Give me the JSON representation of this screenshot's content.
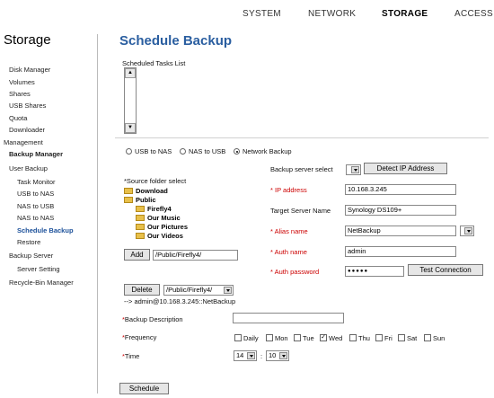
{
  "nav": {
    "system": "SYSTEM",
    "network": "NETWORK",
    "storage": "STORAGE",
    "access": "ACCESS"
  },
  "sidebar": {
    "title": "Storage",
    "items": [
      "Disk Manager",
      "Volumes",
      "Shares",
      "USB Shares",
      "Quota",
      "Downloader",
      "Management",
      "Backup Manager",
      "User Backup",
      "Task Monitor",
      "USB to NAS",
      "NAS to USB",
      "NAS to NAS",
      "Schedule Backup",
      "Restore",
      "Backup Server",
      "Server Setting",
      "Recycle-Bin Manager"
    ]
  },
  "main": {
    "title": "Schedule Backup",
    "tasks_list_label": "Scheduled Tasks List",
    "modes": [
      "USB to NAS",
      "NAS to USB",
      "Network Backup"
    ],
    "selected_mode": "Network Backup",
    "source_label": "*Source folder select",
    "tree": [
      "Download",
      "Public",
      "Firefly4",
      "Our Music",
      "Our Pictures",
      "Our Videos"
    ],
    "add_button": "Add",
    "add_path": "/Public/Firefly4/",
    "delete_button": "Delete",
    "delete_select": "/Public/Firefly4/",
    "route": "--> admin@10.168.3.245::NetBackup",
    "server_select_label": "Backup server select",
    "detect_button": "Detect IP Address",
    "ip_label": "* IP address",
    "ip_value": "10.168.3.245",
    "target_label": "Target Server Name",
    "target_value": "Synology DS109+",
    "alias_label": "* Alias name",
    "alias_value": "NetBackup",
    "authname_label": "* Auth name",
    "authname_value": "admin",
    "authpw_label": "* Auth password",
    "authpw_value": "●●●●●",
    "test_button": "Test Connection",
    "desc_label": "*Backup Description",
    "desc_value": "",
    "freq_label": "*Frequency",
    "days": [
      "Daily",
      "Mon",
      "Tue",
      "Wed",
      "Thu",
      "Fri",
      "Sat",
      "Sun"
    ],
    "days_checked": [
      "Wed"
    ],
    "time_label": "*Time",
    "time_hour": "14",
    "time_sep": ":",
    "time_minute": "10",
    "schedule_button": "Schedule"
  }
}
